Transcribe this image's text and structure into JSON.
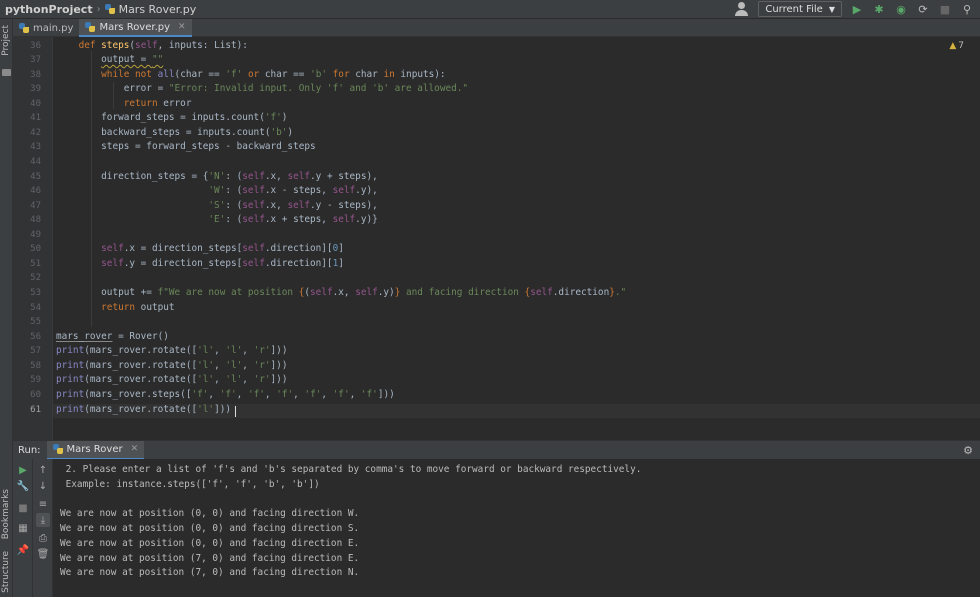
{
  "breadcrumb": {
    "project": "pythonProject",
    "file": "Mars Rover.py"
  },
  "toolbar": {
    "run_config": "Current File"
  },
  "left_strip": {
    "project": "Project",
    "bookmarks": "Bookmarks",
    "structure": "Structure"
  },
  "tabs": [
    {
      "label": "main.py"
    },
    {
      "label": "Mars Rover.py",
      "active": true
    }
  ],
  "editor": {
    "warnings_count": "7",
    "line_numbers": [
      "36",
      "37",
      "38",
      "39",
      "40",
      "41",
      "42",
      "43",
      "44",
      "45",
      "46",
      "47",
      "48",
      "49",
      "50",
      "51",
      "52",
      "53",
      "54",
      "55",
      "56",
      "57",
      "58",
      "59",
      "60",
      "61"
    ],
    "current_line": "61"
  },
  "run_panel": {
    "label": "Run:",
    "tab": "Mars Rover",
    "output": [
      " 2. Please enter a list of 'f's and 'b's separated by comma's to move forward or backward respectively.",
      " Example: instance.steps(['f', 'f', 'b', 'b'])",
      "",
      "We are now at position (0, 0) and facing direction W.",
      "We are now at position (0, 0) and facing direction S.",
      "We are now at position (0, 0) and facing direction E.",
      "We are now at position (7, 0) and facing direction E.",
      "We are now at position (7, 0) and facing direction N."
    ]
  },
  "colors": {
    "keyword": "#cc7832",
    "string": "#6a8759",
    "self": "#94558d",
    "function": "#ffc66d",
    "accent": "#4a88c7"
  }
}
